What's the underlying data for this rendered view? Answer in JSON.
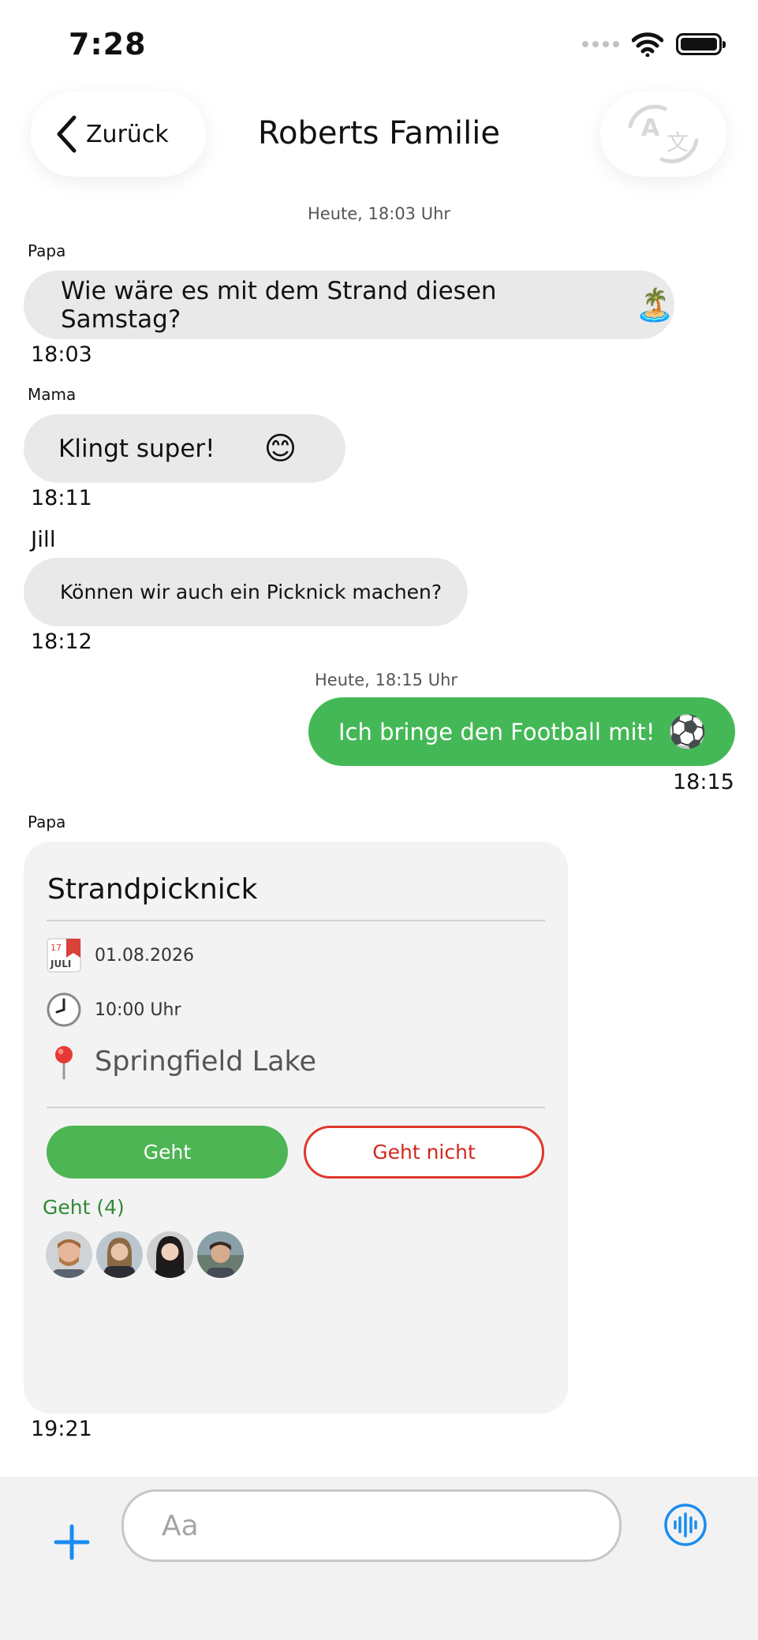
{
  "status_bar": {
    "time": "7:28"
  },
  "header": {
    "back_label": "Zurück",
    "title": "Roberts Familie"
  },
  "messages": [
    {
      "date_separator": "Heute, 18:03 Uhr",
      "sender": "Papa",
      "text": "Wie wäre es mit dem Strand diesen Samstag?",
      "emoji": "🏝️",
      "time": "18:03"
    },
    {
      "sender": "Mama",
      "text": "Klingt super!",
      "emoji": "😊",
      "time": "18:11"
    },
    {
      "sender": "Jill",
      "text": "Können wir auch ein Picknick machen?",
      "time": "18:12"
    },
    {
      "date_separator": "Heute, 18:15 Uhr",
      "text": "Ich bringe den Football mit!",
      "emoji": "⚽",
      "time": "18:15",
      "outgoing": true
    }
  ],
  "event": {
    "sender": "Papa",
    "title": "Strandpicknick",
    "calendar_label": "JULI",
    "calendar_day": "17",
    "date": "01.08.2026",
    "time": "10:00 Uhr",
    "location": "Springfield Lake",
    "going_button": "Geht",
    "not_going_button": "Geht nicht",
    "going_count_label": "Geht (4)",
    "attendee_count": 4,
    "message_time": "19:21"
  },
  "composer": {
    "placeholder": "Aa"
  },
  "colors": {
    "accent": "#1a8cf0",
    "outgoing_bubble": "#44b856",
    "going": "#4db553",
    "not_going": "#e0382c"
  },
  "icons": [
    "back-chevron-icon",
    "translate-icon",
    "calendar-icon",
    "clock-icon",
    "pin-icon",
    "plus-icon",
    "voice-icon",
    "wifi-icon",
    "battery-icon",
    "signal-icon"
  ]
}
